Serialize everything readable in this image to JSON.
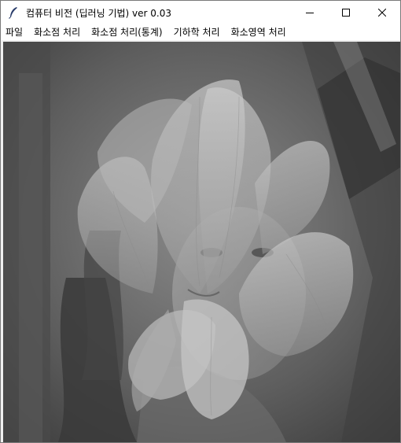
{
  "window": {
    "title": "컴퓨터 비전 (딥러닝 기법) ver 0.03",
    "icon": "feather-icon"
  },
  "controls": {
    "minimize_icon": "minimize-icon",
    "maximize_icon": "maximize-icon",
    "close_icon": "close-icon"
  },
  "menu": {
    "items": [
      {
        "label": "파일"
      },
      {
        "label": "화소점 처리"
      },
      {
        "label": "화소점 처리(통계)"
      },
      {
        "label": "기하학 처리"
      },
      {
        "label": "화소영역 처리"
      }
    ]
  },
  "image": {
    "description_colors": {
      "bg_dark": "#3a3a3a",
      "mid": "#777777",
      "petal": "#c9c9c9"
    }
  }
}
